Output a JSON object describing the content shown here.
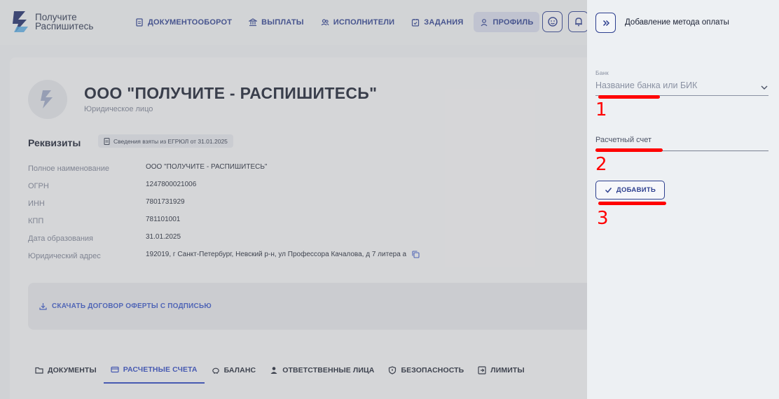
{
  "brand": {
    "line1": "Получите",
    "line2": "Распишитесь"
  },
  "nav": [
    {
      "label": "ДОКУМЕНТООБОРОТ",
      "icon": "document-icon"
    },
    {
      "label": "ВЫПЛАТЫ",
      "icon": "bank-icon"
    },
    {
      "label": "ИСПОЛНИТЕЛИ",
      "icon": "users-icon"
    },
    {
      "label": "ЗАДАНИЯ",
      "icon": "calendar-icon"
    },
    {
      "label": "ПРОФИЛЬ",
      "icon": "user-icon",
      "active": true
    }
  ],
  "company": {
    "name": "ООО \"ПОЛУЧИТЕ - РАСПИШИТЕСЬ\"",
    "type": "Юридическое лицо"
  },
  "requisites": {
    "title": "Реквизиты",
    "badge": "Сведения взяты из ЕГРЮЛ от 31.01.2025",
    "rows": [
      {
        "label": "Полное наименование",
        "value": "ООО \"ПОЛУЧИТЕ - РАСПИШИТЕСЬ\""
      },
      {
        "label": "ОГРН",
        "value": "1247800021006"
      },
      {
        "label": "ИНН",
        "value": "7801731929"
      },
      {
        "label": "КПП",
        "value": "781101001"
      },
      {
        "label": "Дата образования",
        "value": "31.01.2025"
      },
      {
        "label": "Юридический адрес",
        "value": "192019, г Санкт-Петербург, Невский р-н, ул Профессора Качалова, д 7 литера а"
      }
    ]
  },
  "download": {
    "label": "СКАЧАТЬ ДОГОВОР ОФЕРТЫ С ПОДПИСЬЮ"
  },
  "tabs": [
    {
      "label": "ДОКУМЕНТЫ",
      "icon": "folder-icon"
    },
    {
      "label": "РАСЧЕТНЫЕ СЧЕТА",
      "icon": "card-icon",
      "active": true
    },
    {
      "label": "БАЛАНС",
      "icon": "piggy-bank-icon"
    },
    {
      "label": "ОТВЕТСТВЕННЫЕ ЛИЦА",
      "icon": "person-icon"
    },
    {
      "label": "БЕЗОПАСНОСТЬ",
      "icon": "shield-icon"
    },
    {
      "label": "ЛИМИТЫ",
      "icon": "limit-icon"
    }
  ],
  "drawer": {
    "title": "Добавление метода оплаты",
    "bank_label": "Банк",
    "bank_placeholder": "Название банка или БИК",
    "account_placeholder": "Расчетный счет",
    "add_button": "ДОБАВИТЬ"
  },
  "annotations": [
    "1",
    "2",
    "3"
  ],
  "colors": {
    "accent": "#2d3f8f",
    "link": "#3a57c6",
    "marker": "#ff0000"
  }
}
